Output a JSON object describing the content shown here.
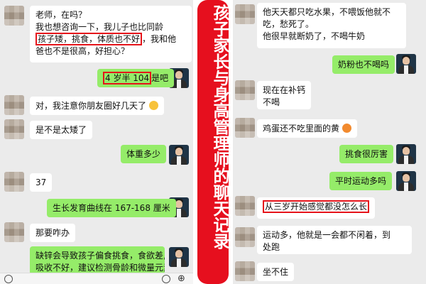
{
  "banner": {
    "title": "孩子家长与身高管理师的聊天记录"
  },
  "left": {
    "m1": {
      "l1": "老师，在吗？",
      "l2": "我也想咨询一下，我儿子也比同龄",
      "l3a": "孩子矮，挑食，体质也不好",
      "l3b": "，我和他",
      "l4": "爸也不是很高，好担心？"
    },
    "m2": {
      "hl": "4 岁半 104",
      "tail": "是吧"
    },
    "m3": {
      "text": "对，我注意你朋友圈好几天了"
    },
    "m4": {
      "text": "是不是太矮了"
    },
    "m5": {
      "text": "体重多少"
    },
    "m6": {
      "text": "37"
    },
    "m7": {
      "text": "生长发育曲线在 167-168 厘米"
    },
    "m8": {
      "text": "那要咋办"
    },
    "m9": {
      "l1": "缺锌会导致孩子偏食挑食，食欲差,",
      "l2": "吸收不好，建议检测骨龄和微量元素"
    }
  },
  "right": {
    "r1": {
      "l1": "他天天都只吃水果，不喂饭他就不",
      "l2": "吃，愁死了。",
      "l3": "他很早就断奶了，不喝牛奶"
    },
    "r2": {
      "text": "奶粉也不喝吗"
    },
    "r3": {
      "l1": "现在在补钙",
      "l2": "不喝"
    },
    "r4": {
      "text": "鸡蛋还不吃里面的黄"
    },
    "r5": {
      "text": "挑食很厉害"
    },
    "r6": {
      "text": "平时运动多吗"
    },
    "r7": {
      "text": "从三岁开始感觉都没怎么长"
    },
    "r8": {
      "l1": "运动多，他就是一会都不闲着，到",
      "l2": "处跑"
    },
    "r9": {
      "text": "坐不住"
    }
  },
  "icons": {
    "smile": "smile-emoji-icon",
    "egg": "angry-emoji-icon",
    "voice": "voice-icon",
    "emoji": "emoji-icon",
    "plus": "plus-icon"
  },
  "colors": {
    "accent": "#e60f1e",
    "sent": "#95ec69",
    "received": "#ffffff",
    "background": "#ebebeb"
  }
}
